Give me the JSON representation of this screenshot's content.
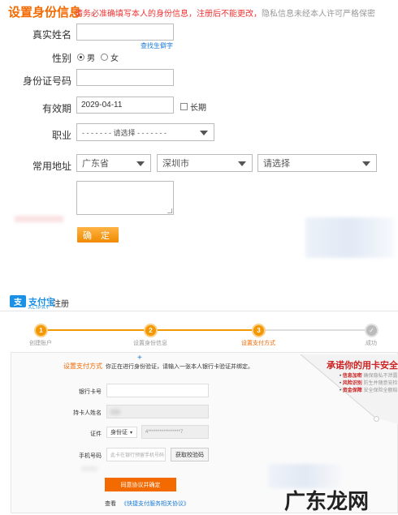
{
  "top": {
    "title": "设置身份信息",
    "notice_hl": "请务必准确填写本人的身份信息，注册后不能更改，",
    "notice_rest": "隐私信息未经本人许可严格保密",
    "name_label": "真实姓名",
    "name_link": "查找生僻字",
    "gender_label": "性别",
    "male": "男",
    "female": "女",
    "id_label": "身份证号码",
    "valid_label": "有效期",
    "valid_value": "2029-04-11",
    "long_term": "长期",
    "job_label": "职业",
    "job_placeholder": "- - - - - - - 请选择 - - - - - - -",
    "addr_label": "常用地址",
    "province": "广东省",
    "city": "深圳市",
    "district": "请选择",
    "confirm": "确 定"
  },
  "bottom": {
    "logo_text": "支付宝",
    "logo_sub": "ALIPAY",
    "register": "注册",
    "steps": [
      {
        "num": "1",
        "label": "创建账户"
      },
      {
        "num": "2",
        "label": "设置身份信息"
      },
      {
        "num": "3",
        "label": "设置支付方式"
      },
      {
        "num": "✓",
        "label": "成功"
      }
    ],
    "section_title": "设置支付方式",
    "section_desc": "你正在进行身份验证，请输入一张本人银行卡验证并绑定。",
    "card_label": "银行卡号",
    "holder_label": "持卡人姓名",
    "cert_label": "证件",
    "cert_type": "身份证",
    "cert_value": "4*****************7",
    "phone_label": "手机号码",
    "phone_placeholder": "此卡在银行预留手机号码",
    "get_code": "获取校验码",
    "agree_btn": "同意协议并确定",
    "view": "查看",
    "agreement_link": "《快捷支付服务相关协议》",
    "promo_title": "承诺你的用卡安全",
    "promo_items": [
      {
        "title": "信息加密",
        "desc": "确保隐私不泄露"
      },
      {
        "title": "风险识别",
        "desc": "防生并随意安检"
      },
      {
        "title": "资金保障",
        "desc": "安全保险全额赔"
      }
    ],
    "watermark": "广东龙网"
  },
  "colors": {
    "accent": "#f26a00",
    "alipay_blue": "#1a91e6",
    "link": "#1a7ad6"
  }
}
